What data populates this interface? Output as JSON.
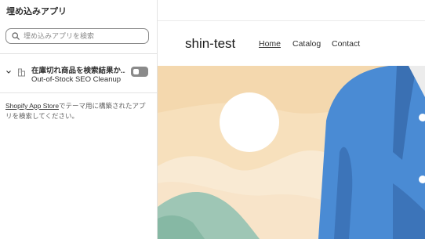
{
  "sidebar": {
    "title": "埋め込みアプリ",
    "search_placeholder": "埋め込みアプリを検索",
    "apps": [
      {
        "title": "在庫切れ商品を検索結果か...",
        "subtitle": "Out-of-Stock SEO Cleanup",
        "enabled": false
      }
    ],
    "note_link": "Shopify App Store",
    "note_text": "でテーマ用に構築されたアプリを検索してください。"
  },
  "preview": {
    "store_name": "shin-test",
    "nav": [
      "Home",
      "Catalog",
      "Contact"
    ],
    "active_nav": "Home"
  },
  "colors": {
    "hero_bg": "#f4d8ae",
    "sun": "#ffffff",
    "jacket": "#4a8bd4"
  }
}
